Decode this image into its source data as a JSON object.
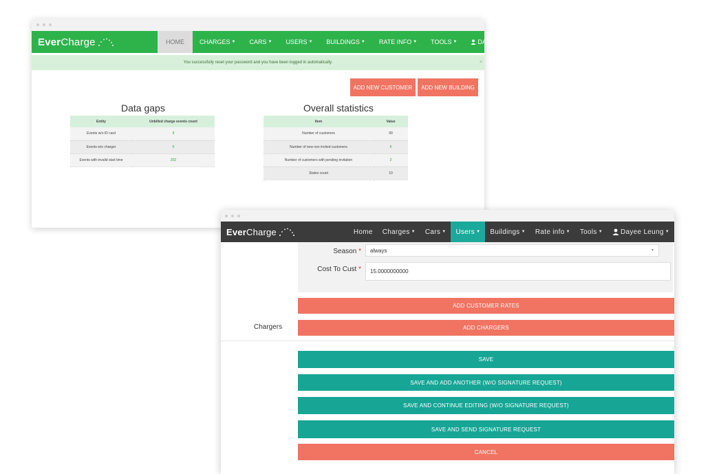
{
  "window1": {
    "brand": {
      "bold": "Ever",
      "regular": "Charge"
    },
    "nav": [
      {
        "label": "HOME",
        "caret": false,
        "active": true
      },
      {
        "label": "CHARGES",
        "caret": true
      },
      {
        "label": "CARS",
        "caret": true
      },
      {
        "label": "USERS",
        "caret": true
      },
      {
        "label": "BUILDINGS",
        "caret": true
      },
      {
        "label": "RATE INFO",
        "caret": true
      },
      {
        "label": "TOOLS",
        "caret": true
      }
    ],
    "user": "DAYEE LEUNG",
    "alert": "You successfully reset your password and you have been logged in automatically.",
    "alert_close": "×",
    "actions": {
      "add_customer": "ADD NEW CUSTOMER",
      "add_building": "ADD NEW BUILDING"
    },
    "data_gaps": {
      "title": "Data gaps",
      "headers": [
        "Entity",
        "Unbilled charge events count"
      ],
      "rows": [
        [
          "Events w/o ID card",
          "9"
        ],
        [
          "Events w/o charger",
          "0"
        ],
        [
          "Events with invalid start time",
          "202"
        ]
      ]
    },
    "overall": {
      "title": "Overall statistics",
      "headers": [
        "Item",
        "Value"
      ],
      "rows": [
        [
          "Number of customers",
          "99"
        ],
        [
          "Number of new non invited customers",
          "6"
        ],
        [
          "Number of customers with pending invitation",
          "2"
        ],
        [
          "States count",
          "10"
        ]
      ]
    }
  },
  "window2": {
    "brand": {
      "bold": "Ever",
      "regular": "Charge"
    },
    "nav": [
      {
        "label": "Home",
        "caret": false
      },
      {
        "label": "Charges",
        "caret": true
      },
      {
        "label": "Cars",
        "caret": true
      },
      {
        "label": "Users",
        "caret": true,
        "active": true
      },
      {
        "label": "Buildings",
        "caret": true
      },
      {
        "label": "Rate info",
        "caret": true
      },
      {
        "label": "Tools",
        "caret": true
      }
    ],
    "user": "Dayee Leung",
    "form": {
      "season_label": "Season",
      "season_value": "always",
      "cost_label": "Cost To Cust",
      "cost_value": "15.0000000000",
      "required_mark": "*"
    },
    "add_rates": "ADD CUSTOMER RATES",
    "chargers_label": "Chargers",
    "add_chargers": "ADD CHARGERS",
    "buttons": {
      "save": "SAVE",
      "save_add": "SAVE AND ADD ANOTHER (W/O SIGNATURE REQUEST)",
      "save_continue": "SAVE AND CONTINUE EDITING (W/O SIGNATURE REQUEST)",
      "save_send": "SAVE AND SEND SIGNATURE REQUEST",
      "cancel": "CANCEL"
    }
  },
  "colors": {
    "green_nav": "#2db34a",
    "dark_nav": "#3b3b3b",
    "salmon": "#f07461",
    "teal": "#17a596"
  }
}
